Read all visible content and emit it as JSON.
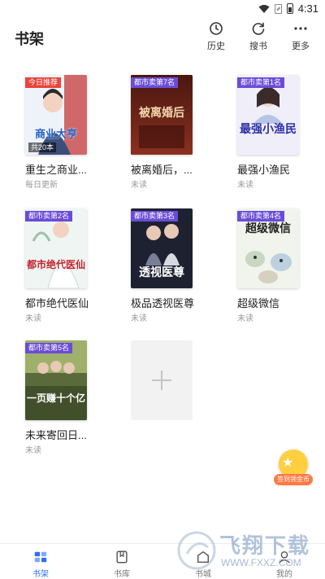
{
  "status_bar": {
    "time": "4:31"
  },
  "header": {
    "title": "书架",
    "actions": [
      {
        "label": "历史",
        "icon": "clock-icon"
      },
      {
        "label": "搜书",
        "icon": "search-refresh-icon"
      },
      {
        "label": "更多",
        "icon": "more-icon"
      }
    ]
  },
  "books": [
    {
      "title": "重生之商业...",
      "status": "每日更新",
      "tag": "今日推荐",
      "tag_color": "#e8453c",
      "cover_text": "商业大亨",
      "count_badge": "共20本",
      "cover_bg": "#eef3fa",
      "cover_text_color": "#1f5fc8"
    },
    {
      "title": "被离婚后，...",
      "status": "未读",
      "tag": "都市卖第7名",
      "tag_color": "#6a4cd8",
      "cover_text": "被离婚后",
      "cover_bg": "#6b2418",
      "cover_text_color": "#f3d9b0"
    },
    {
      "title": "最强小渔民",
      "status": "未读",
      "tag": "都市卖第1名",
      "tag_color": "#6a4cd8",
      "cover_text": "最强小渔民",
      "cover_bg": "#f0eef8",
      "cover_text_color": "#2b2fa8"
    },
    {
      "title": "都市绝代医仙",
      "status": "未读",
      "tag": "都市卖第2名",
      "tag_color": "#6a4cd8",
      "cover_text": "都市绝代医仙",
      "cover_bg": "#eef5f2",
      "cover_text_color": "#c4232e"
    },
    {
      "title": "极品透视医尊",
      "status": "未读",
      "tag": "都市卖第3名",
      "tag_color": "#6a4cd8",
      "cover_text": "透视医尊",
      "cover_bg": "#1e2230",
      "cover_text_color": "#ffffff"
    },
    {
      "title": "超级微信",
      "status": "未读",
      "tag": "都市卖第4名",
      "tag_color": "#6a4cd8",
      "cover_text": "超级微信",
      "cover_bg": "#f0f4ec",
      "cover_text_color": "#222222"
    },
    {
      "title": "未来寄回日...",
      "status": "未读",
      "tag": "都市卖第5名",
      "tag_color": "#6a4cd8",
      "cover_text": "一页赚十个亿",
      "cover_bg": "#5a6a3a",
      "cover_text_color": "#ffffff"
    }
  ],
  "add_book": {
    "icon": "plus-icon"
  },
  "float_button": {
    "label": "签到领金币"
  },
  "bottom_nav": [
    {
      "label": "书架",
      "icon": "bookshelf-icon",
      "active": true
    },
    {
      "label": "书库",
      "icon": "library-icon",
      "active": false
    },
    {
      "label": "书城",
      "icon": "bookstore-icon",
      "active": false
    },
    {
      "label": "我的",
      "icon": "profile-icon",
      "active": false
    }
  ],
  "watermark": {
    "brand": "飞翔下载",
    "url": "WWW.FXXZ.COM"
  },
  "colors": {
    "accent": "#2f6ef6",
    "rank_tag": "#6a4cd8",
    "recommend_tag": "#e8453c"
  }
}
